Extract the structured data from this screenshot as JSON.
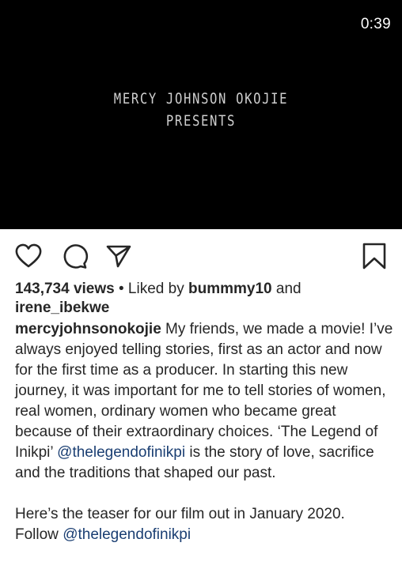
{
  "video": {
    "time": "0:39",
    "overlay_line1": "MERCY JOHNSON OKOJIE",
    "overlay_line2": "PRESENTS"
  },
  "actions": {
    "icons": [
      "heart-icon",
      "comment-icon",
      "share-icon",
      "bookmark-icon"
    ]
  },
  "stats": {
    "views": "143,734 views",
    "separator": " • Liked by ",
    "liker1": "bummmy10",
    "and": " and",
    "liker2": "irene_ibekwe"
  },
  "caption": {
    "username": "mercyjohnsonokojie",
    "text1": " My friends, we made a movie! I’ve always enjoyed telling stories, first as an actor and now for the first time as a producer. In starting this new journey, it was important for me to tell stories of women, real women, ordinary women who became great because of their extraordinary choices. ‘The Legend of Inikpi’ ",
    "mention1": "@thelegendofinikpi",
    "text2": " is the story of love, sacrifice and the traditions that shaped our past.",
    "para2": "Here’s the teaser for our film out in January 2020.",
    "follow": "Follow ",
    "mention2": "@thelegendofinikpi"
  },
  "colors": {
    "link": "#1a3e72",
    "text": "#262626",
    "video_bg": "#000000"
  }
}
